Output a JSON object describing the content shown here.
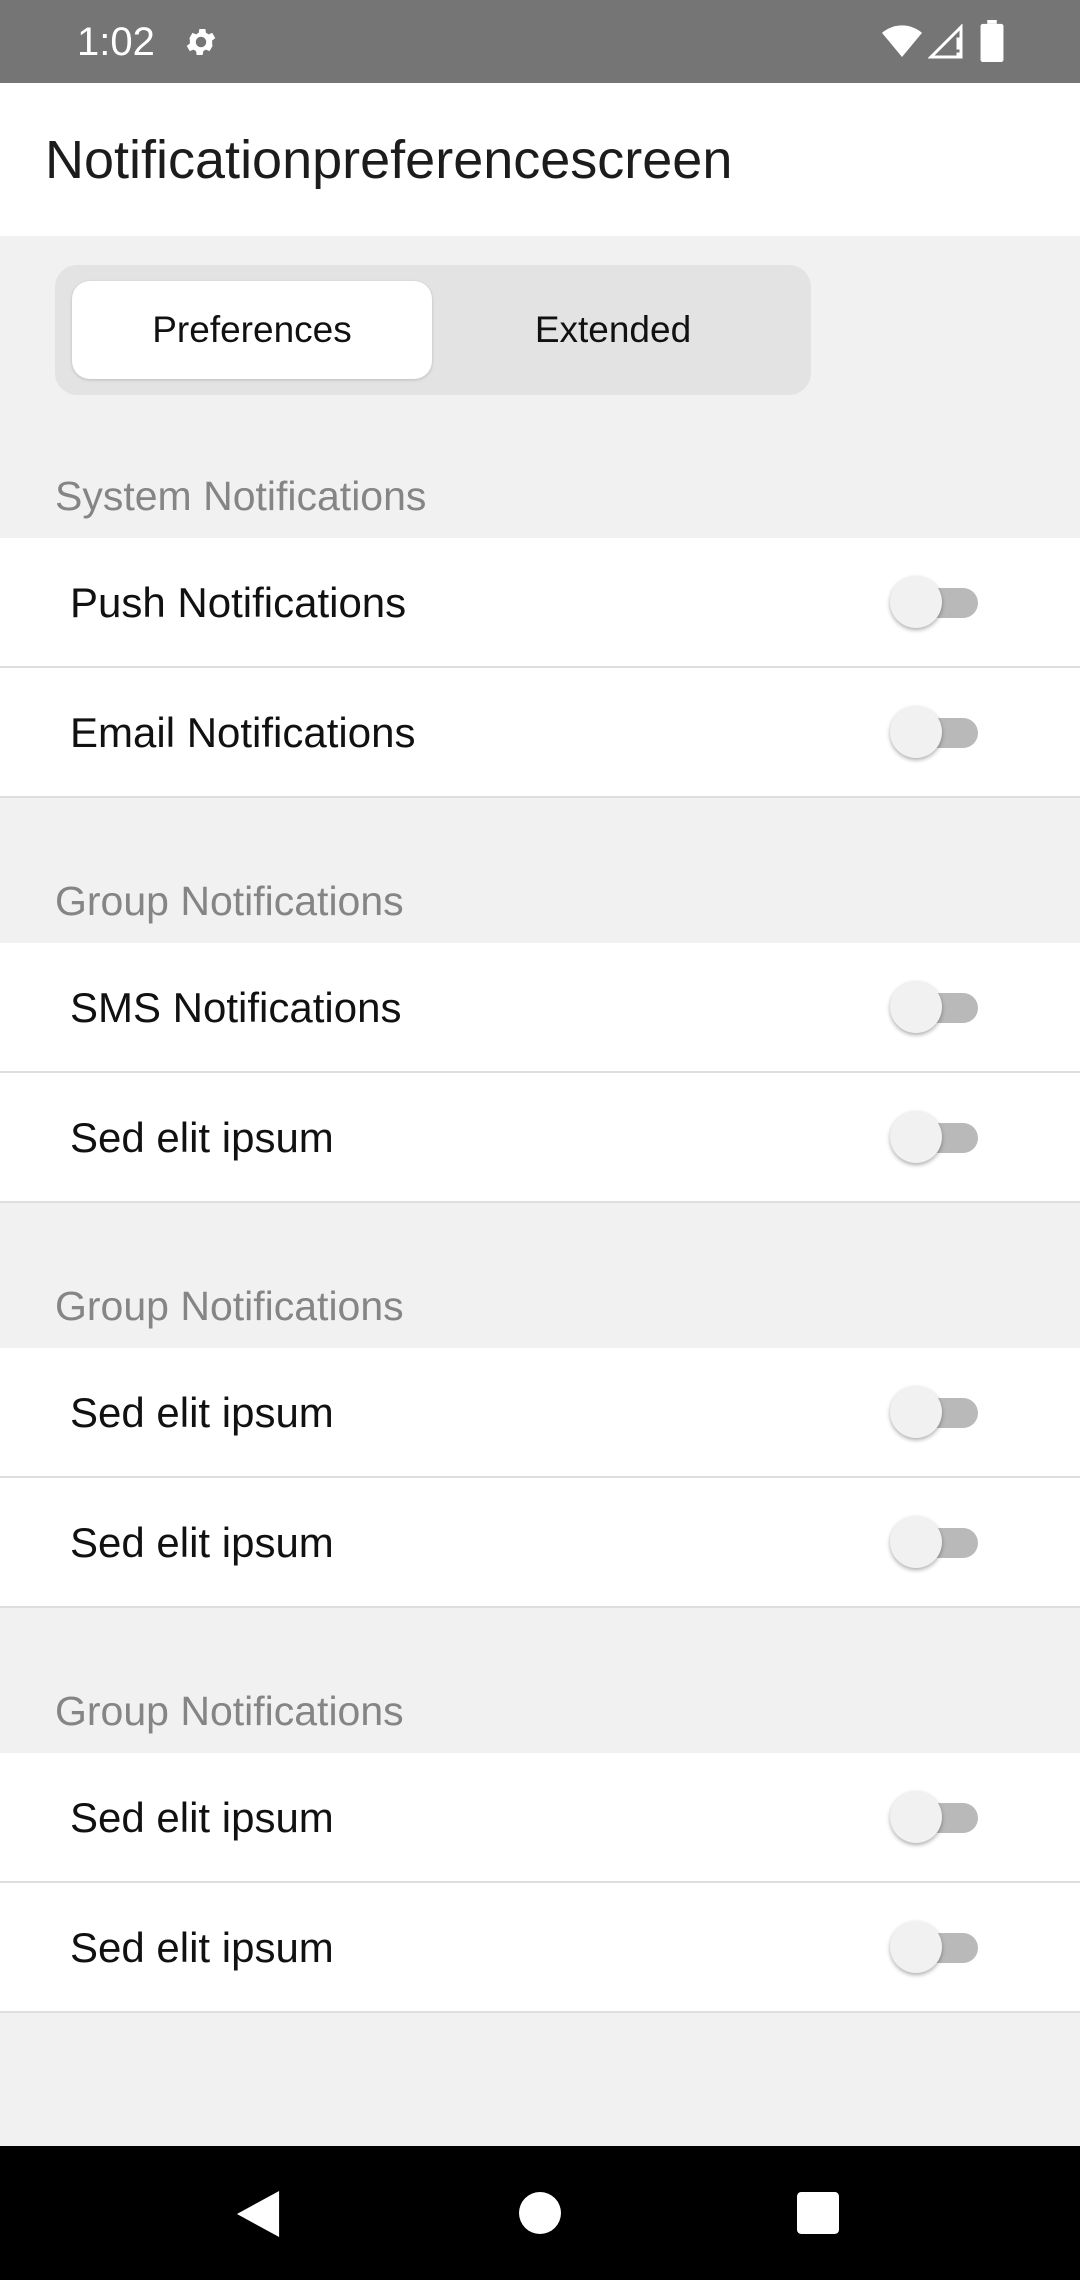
{
  "status_bar": {
    "time": "1:02",
    "icons": [
      "gear-icon",
      "wifi-icon",
      "signal-icon",
      "battery-icon"
    ]
  },
  "app_bar": {
    "title": "Notificationpreferencescreen"
  },
  "tabs": [
    {
      "label": "Preferences",
      "selected": true
    },
    {
      "label": "Extended",
      "selected": false
    }
  ],
  "sections": [
    {
      "header": "System Notifications",
      "items": [
        {
          "label": "Push Notifications",
          "enabled": false
        },
        {
          "label": "Email Notifications",
          "enabled": false
        }
      ]
    },
    {
      "header": "Group Notifications",
      "items": [
        {
          "label": "SMS Notifications",
          "enabled": false
        },
        {
          "label": "Sed elit ipsum",
          "enabled": false
        }
      ]
    },
    {
      "header": "Group Notifications",
      "items": [
        {
          "label": "Sed elit ipsum",
          "enabled": false
        },
        {
          "label": "Sed elit ipsum",
          "enabled": false
        }
      ]
    },
    {
      "header": "Group Notifications",
      "items": [
        {
          "label": "Sed elit ipsum",
          "enabled": false
        },
        {
          "label": "Sed elit ipsum",
          "enabled": false
        }
      ]
    }
  ],
  "nav_bar": {
    "icons": [
      "back-icon",
      "home-icon",
      "recents-icon"
    ]
  },
  "colors": {
    "status_bar": "#757575",
    "background": "#f1f1f1",
    "row": "#ffffff",
    "section_header_text": "#858585",
    "switch_track_off": "#b9b9b9",
    "nav_bar": "#000000"
  }
}
